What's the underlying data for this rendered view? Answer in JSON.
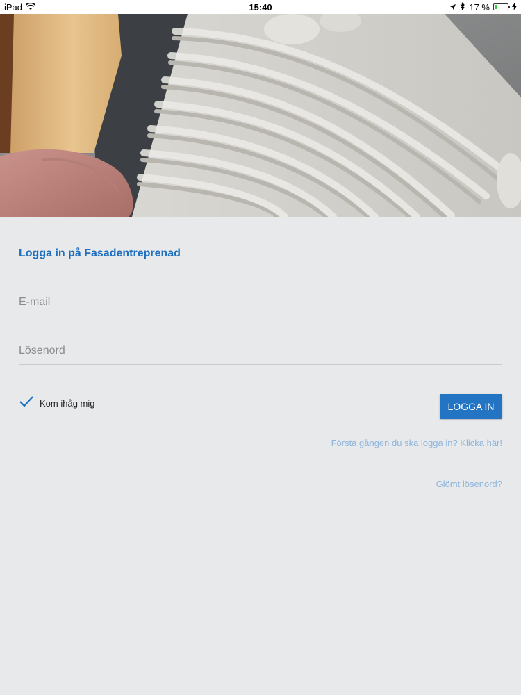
{
  "status_bar": {
    "device": "iPad",
    "time": "15:40",
    "battery": "17 %",
    "icons": [
      "wifi-icon",
      "location-arrow-icon",
      "bluetooth-icon",
      "battery-icon",
      "charging-bolt-icon"
    ]
  },
  "hero": {
    "image": "trowel-spreading-mortar-photo"
  },
  "login": {
    "title": "Logga in på Fasadentreprenad",
    "email_placeholder": "E-mail",
    "password_placeholder": "Lösenord",
    "remember_label": "Kom ihåg mig",
    "remember_checked": true,
    "login_button": "LOGGA IN",
    "first_time_link": "Första gången du ska logga in? Klicka här!",
    "forgot_link": "Glömt lösenord?"
  },
  "colors": {
    "accent": "#2375c3",
    "title": "#1f6fbf",
    "link": "#8db5dd",
    "background": "#e8e9eb"
  }
}
